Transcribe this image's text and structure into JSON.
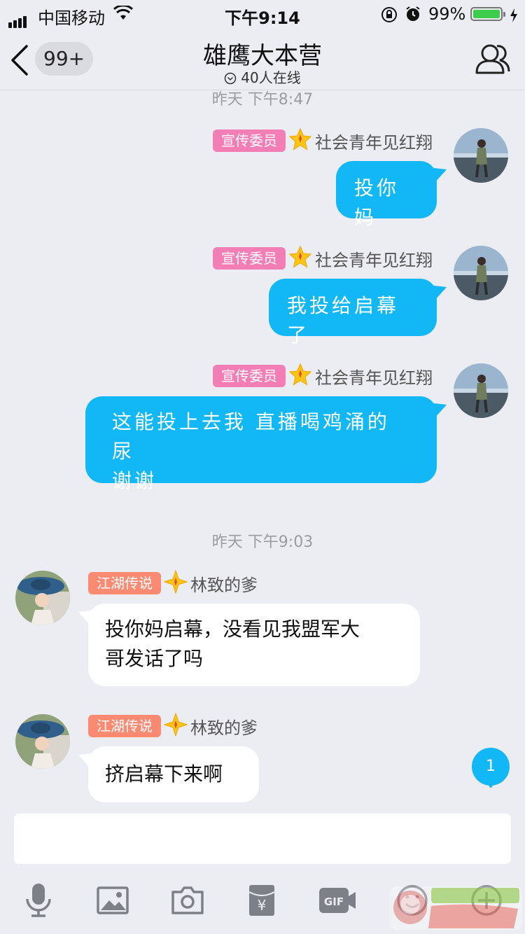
{
  "status_bar": {
    "carrier": "中国移动",
    "time": "下午9:14",
    "battery_percent": "99%",
    "battery_level": 0.99
  },
  "nav": {
    "back_count": "99+",
    "title": "雄鹰大本营",
    "online": "40人在线"
  },
  "messages": [
    {
      "type": "timestamp",
      "text": "昨天 下午8:47"
    },
    {
      "type": "out",
      "tag": "宣传委员",
      "nickname": "社会青年见红翔",
      "text": "投你妈"
    },
    {
      "type": "out",
      "tag": "宣传委员",
      "nickname": "社会青年见红翔",
      "text": "我投给启幕了"
    },
    {
      "type": "out",
      "tag": "宣传委员",
      "nickname": "社会青年见红翔",
      "text_line1": "这能投上去我 直播喝鸡涌的尿",
      "text_line2": "谢谢"
    },
    {
      "type": "timestamp",
      "text": "昨天 下午9:03"
    },
    {
      "type": "in",
      "tag": "江湖传说",
      "nickname": "林致的爹",
      "text_line1": "投你妈启幕，没看见我盟军大",
      "text_line2": "哥发话了吗"
    },
    {
      "type": "in",
      "tag": "江湖传说",
      "nickname": "林致的爹",
      "text": "挤启幕下来啊"
    }
  ],
  "unread_badge": "1",
  "input": {
    "value": "",
    "placeholder": ""
  },
  "toolbar": {
    "icons": [
      "microphone-icon",
      "image-icon",
      "camera-icon",
      "red-packet-icon",
      "gif-icon",
      "emoji-icon",
      "plus-icon"
    ],
    "gif_label": "GIF",
    "red_packet_symbol": "¥"
  },
  "colors": {
    "bubble_out": "#12b7f5",
    "tag_pink": "#f27eb5",
    "tag_orange": "#fb8a73",
    "background": "#ebedf2"
  }
}
